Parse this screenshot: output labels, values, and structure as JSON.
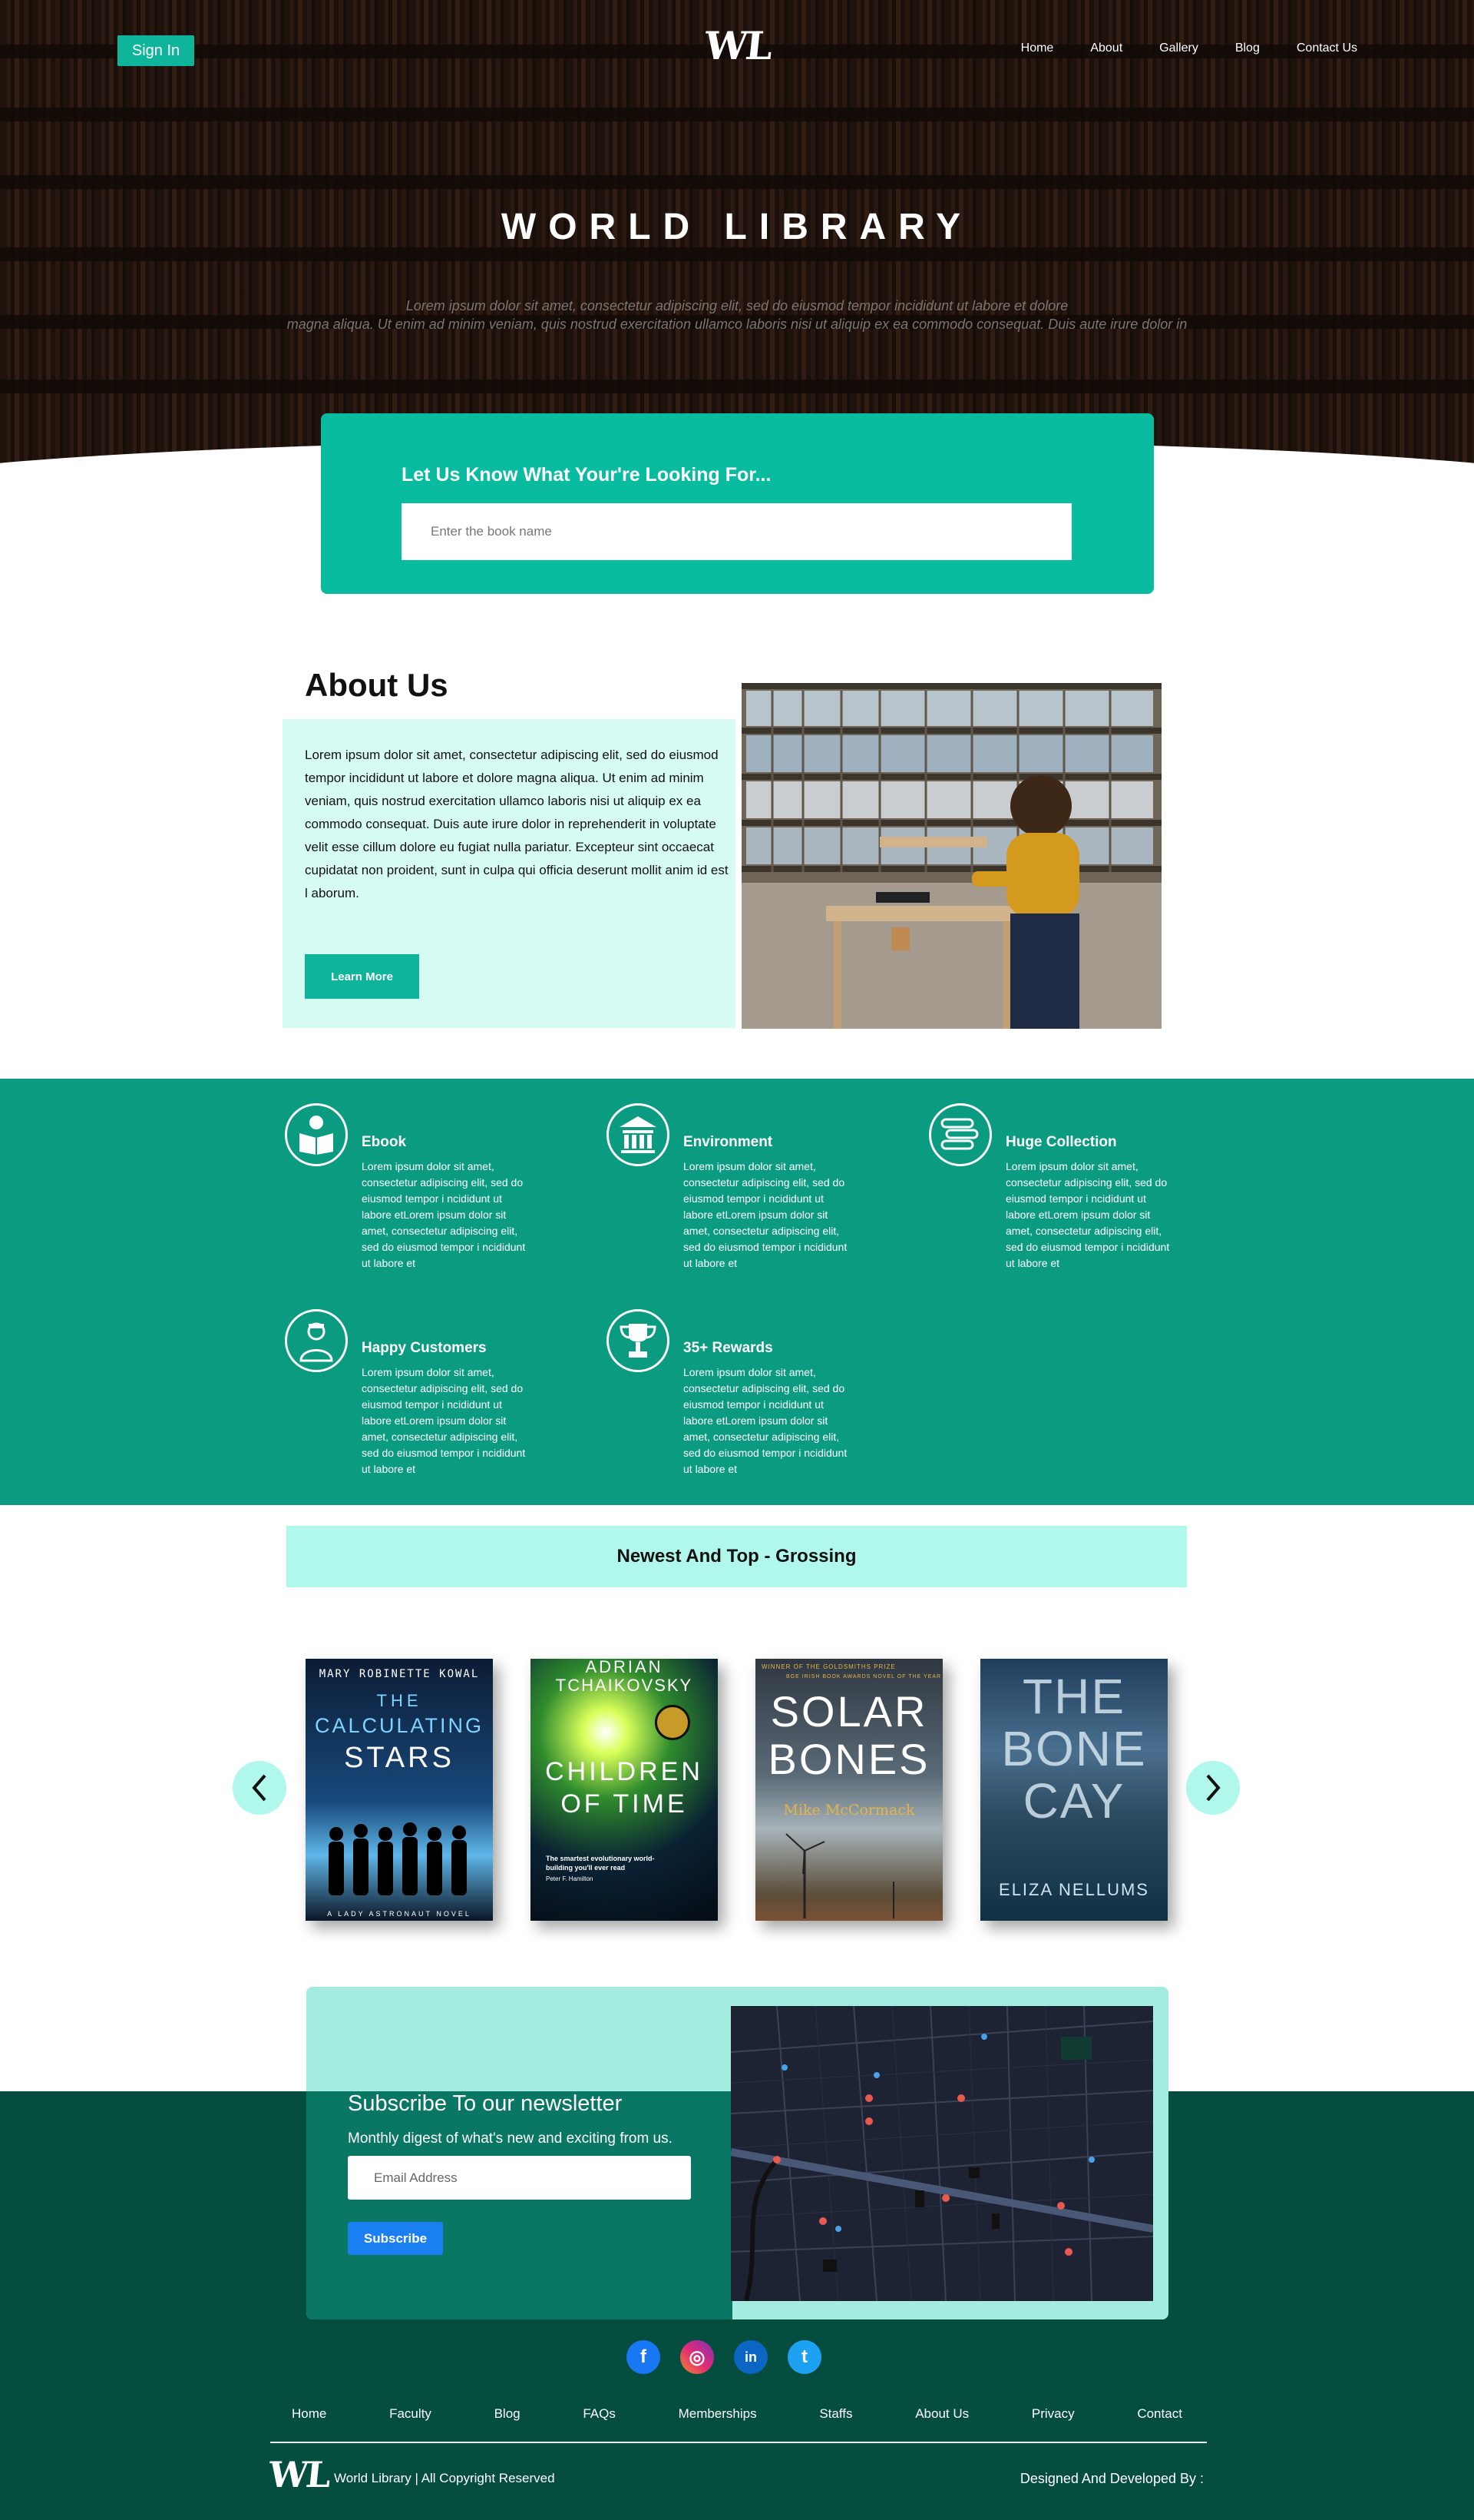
{
  "header": {
    "signin_label": "Sign In",
    "logo_text": "WL",
    "nav": [
      "Home",
      "About",
      "Gallery",
      "Blog",
      "Contact Us"
    ]
  },
  "hero": {
    "title": "WORLD LIBRARY",
    "subtitle_line1": "Lorem ipsum dolor sit amet, consectetur adipiscing elit, sed do eiusmod tempor incididunt ut labore et dolore",
    "subtitle_line2": "magna aliqua. Ut enim ad minim veniam, quis nostrud exercitation ullamco laboris nisi ut aliquip ex ea commodo consequat. Duis aute irure dolor in"
  },
  "search": {
    "title": "Let Us Know What Your're Looking For...",
    "placeholder": "Enter the book name"
  },
  "about": {
    "title": "About Us",
    "text": "Lorem ipsum dolor sit amet, consectetur adipiscing elit, sed do eiusmod tempor incididunt ut labore et dolore magna aliqua. Ut enim ad minim veniam, quis nostrud exercitation ullamco laboris nisi ut aliquip ex ea commodo consequat. Duis aute irure dolor in reprehenderit in voluptate velit esse cillum dolore eu fugiat nulla pariatur. Excepteur sint occaecat cupidatat non proident, sunt in culpa qui officia deserunt mollit anim id est l aborum.",
    "button_label": "Learn More"
  },
  "features": [
    {
      "title": "Ebook",
      "icon": "reader-icon",
      "desc": "Lorem ipsum dolor sit amet, consectetur adipiscing elit, sed do eiusmod tempor i ncididunt ut labore etLorem ipsum dolor sit amet, consectetur adipiscing elit, sed do eiusmod tempor i ncididunt ut labore et"
    },
    {
      "title": "Environment",
      "icon": "building-icon",
      "desc": "Lorem ipsum dolor sit amet, consectetur adipiscing elit, sed do eiusmod tempor i ncididunt ut labore etLorem ipsum dolor sit amet, consectetur adipiscing elit, sed do eiusmod tempor i ncididunt ut labore et"
    },
    {
      "title": "Huge Collection",
      "icon": "books-stack-icon",
      "desc": "Lorem ipsum dolor sit amet, consectetur adipiscing elit, sed do eiusmod tempor i ncididunt ut labore etLorem ipsum dolor sit amet, consectetur adipiscing elit, sed do eiusmod tempor i ncididunt ut labore et"
    },
    {
      "title": "Happy Customers",
      "icon": "customer-icon",
      "desc": "Lorem ipsum dolor sit amet, consectetur adipiscing elit, sed do eiusmod tempor i ncididunt ut labore etLorem ipsum dolor sit amet, consectetur adipiscing elit, sed do eiusmod tempor i ncididunt ut labore et"
    },
    {
      "title": "35+ Rewards",
      "icon": "trophy-icon",
      "desc": "Lorem ipsum dolor sit amet, consectetur adipiscing elit, sed do eiusmod tempor i ncididunt ut labore etLorem ipsum dolor sit amet, consectetur adipiscing elit, sed do eiusmod tempor i ncididunt ut labore et"
    }
  ],
  "books": {
    "heading": "Newest And Top - Grossing",
    "items": [
      {
        "author": "MARY ROBINETTE KOWAL",
        "title_line1": "THE",
        "title_line2": "CALCULATING",
        "title_line3": "STARS",
        "footer": "A LADY ASTRONAUT NOVEL"
      },
      {
        "author_line1": "ADRIAN",
        "author_line2": "TCHAIKOVSKY",
        "title_line1": "CHILDREN",
        "title_line2": "OF TIME",
        "blurb": "The smartest evolutionary world-building you'll ever read",
        "blurb_by": "Peter F. Hamilton"
      },
      {
        "prize": "WINNER OF THE GOLDSMITHS PRIZE",
        "prize2": "BGE IRISH BOOK AWARDS NOVEL OF THE YEAR",
        "title_line1": "SOLAR",
        "title_line2": "BONES",
        "author": "Mike McCormack"
      },
      {
        "title_line1": "THE",
        "title_line2": "BONE",
        "title_line3": "CAY",
        "author": "ELIZA NELLUMS"
      }
    ]
  },
  "newsletter": {
    "title": "Subscribe To our newsletter",
    "subtitle": "Monthly digest of what's new and exciting from us.",
    "placeholder": "Email Address",
    "button_label": "Subscribe"
  },
  "footer": {
    "social": [
      {
        "name": "facebook-icon",
        "glyph": "f",
        "color": "#1877f2"
      },
      {
        "name": "instagram-icon",
        "glyph": "◎",
        "color": "#d6249f"
      },
      {
        "name": "linkedin-icon",
        "glyph": "in",
        "color": "#0a66c2"
      },
      {
        "name": "twitter-icon",
        "glyph": "t",
        "color": "#1da1f2"
      }
    ],
    "links": [
      "Home",
      "Faculty",
      "Blog",
      "FAQs",
      "Memberships",
      "Staffs",
      "About Us",
      "Privacy",
      "Contact"
    ],
    "logo_text": "WL",
    "copyright": "World Library | All Copyright Reserved",
    "designed_by": "Designed And Developed By :"
  },
  "colors": {
    "accent": "#0fb59a",
    "features_bg": "#0a9b80",
    "footer_bg": "#044d3f",
    "light_mint": "#aff8eb",
    "subscribe_blue": "#1a7ff0"
  }
}
